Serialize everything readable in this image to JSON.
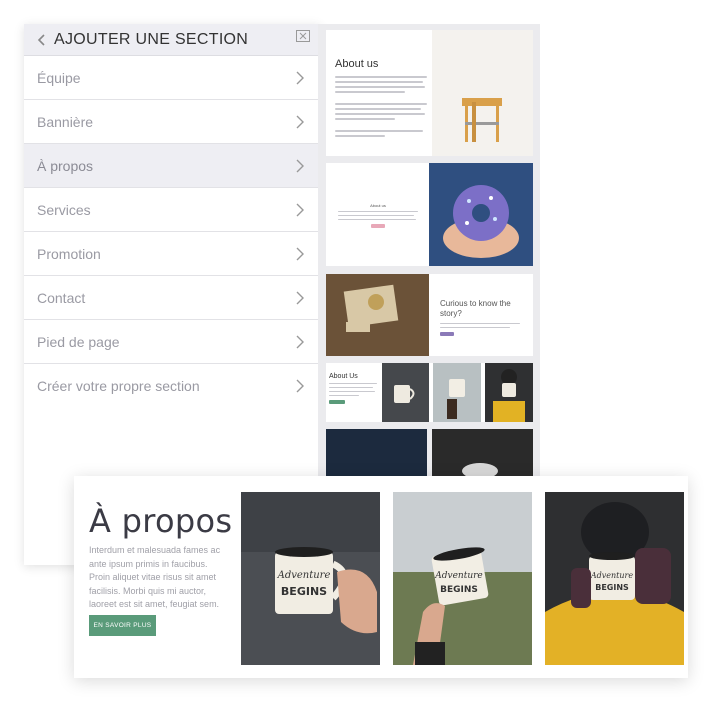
{
  "panel": {
    "title": "AJOUTER UNE SECTION",
    "items": [
      {
        "label": "Équipe",
        "active": false
      },
      {
        "label": "Bannière",
        "active": false
      },
      {
        "label": "À propos",
        "active": true
      },
      {
        "label": "Services",
        "active": false
      },
      {
        "label": "Promotion",
        "active": false
      },
      {
        "label": "Contact",
        "active": false
      },
      {
        "label": "Pied de page",
        "active": false
      },
      {
        "label": "Créer votre propre section",
        "active": false
      }
    ]
  },
  "preview": {
    "card1_heading": "About us",
    "card2_heading": "About us",
    "card3_heading": "Curious to know the story?",
    "card4_heading": "About Us"
  },
  "overlay": {
    "title": "À propos",
    "body": "Interdum et malesuada fames ac ante ipsum primis in faucibus. Proin aliquet vitae risus sit amet facilisis. Morbi quis mi auctor, laoreet est sit amet, feugiat sem.",
    "button_label": "EN SAVOIR PLUS"
  },
  "colors": {
    "accent_green": "#5a9b7a",
    "pink_button": "#e8a8b8",
    "purple_button": "#8b7ab8"
  }
}
